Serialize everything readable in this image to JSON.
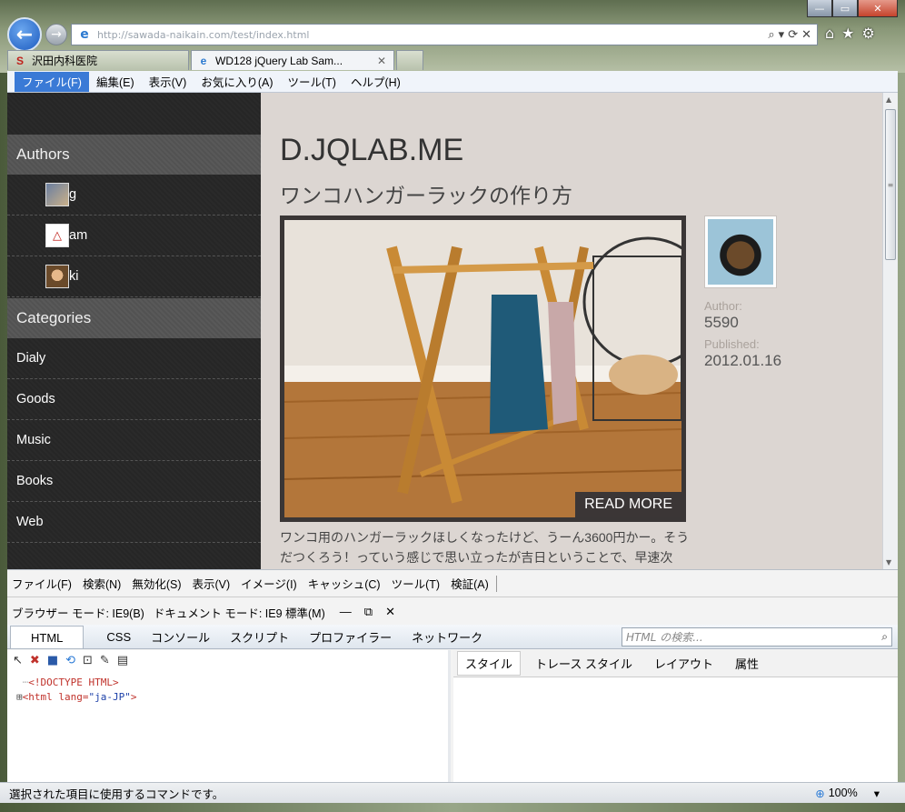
{
  "window": {
    "controls": {
      "minimize": "—",
      "maximize": "▭",
      "close": "✕"
    }
  },
  "navigation": {
    "back": "←",
    "forward": "→",
    "address_url": "http://sawada-naikain.com/test/index.html",
    "address_tools": [
      "⌕",
      "▾",
      "⟳",
      "✕"
    ],
    "home_icon": "⌂",
    "favorites_icon": "★",
    "tools_icon": "⚙"
  },
  "tabs": [
    {
      "label": "沢田内科医院",
      "icon": "S"
    },
    {
      "label": "WD128 jQuery Lab Sam...",
      "icon": "e",
      "close": "✕"
    }
  ],
  "menubar": [
    "ファイル(F)",
    "編集(E)",
    "表示(V)",
    "お気に入り(A)",
    "ツール(T)",
    "ヘルプ(H)"
  ],
  "sidebar": {
    "authors_title": "Authors",
    "authors": [
      {
        "name": "g",
        "avatar_color": "#6b7fa0"
      },
      {
        "name": "am",
        "avatar_color": "#ffffff"
      },
      {
        "name": "ki",
        "avatar_color": "#b08860"
      }
    ],
    "categories_title": "Categories",
    "categories": [
      "Dialy",
      "Goods",
      "Music",
      "Books",
      "Web"
    ]
  },
  "main": {
    "site_title": "D.JQLAB.ME",
    "post_title": "ワンコハンガーラックの作り方",
    "read_more": "READ MORE",
    "excerpt": "ワンコ用のハンガーラックほしくなったけど、うーん3600円かー。そうだつくろう！っていう感じで思い立ったが吉日ということで、早速次",
    "author_label": "Author:",
    "author_value": "5590",
    "published_label": "Published:",
    "published_value": "2012.01.16"
  },
  "devtools": {
    "menu": [
      "ファイル(F)",
      "検索(N)",
      "無効化(S)",
      "表示(V)",
      "イメージ(I)",
      "キャッシュ(C)",
      "ツール(T)",
      "検証(A)"
    ],
    "browser_mode": "ブラウザー モード: IE9(B)",
    "document_mode": "ドキュメント モード: IE9 標準(M)",
    "tabs": [
      "HTML",
      "CSS",
      "コンソール",
      "スクリプト",
      "プロファイラー",
      "ネットワーク"
    ],
    "search_placeholder": "HTML の検索...",
    "code_line1": "<!DOCTYPE HTML>",
    "code_line2_tag_open": "<html ",
    "code_line2_attr": "lang=",
    "code_line2_val": "\"ja-JP\"",
    "code_line2_tag_close": ">",
    "right_tabs": [
      "スタイル",
      "トレース スタイル",
      "レイアウト",
      "属性"
    ]
  },
  "statusbar": {
    "text": "選択された項目に使用するコマンドです。",
    "zoom": "100%"
  }
}
